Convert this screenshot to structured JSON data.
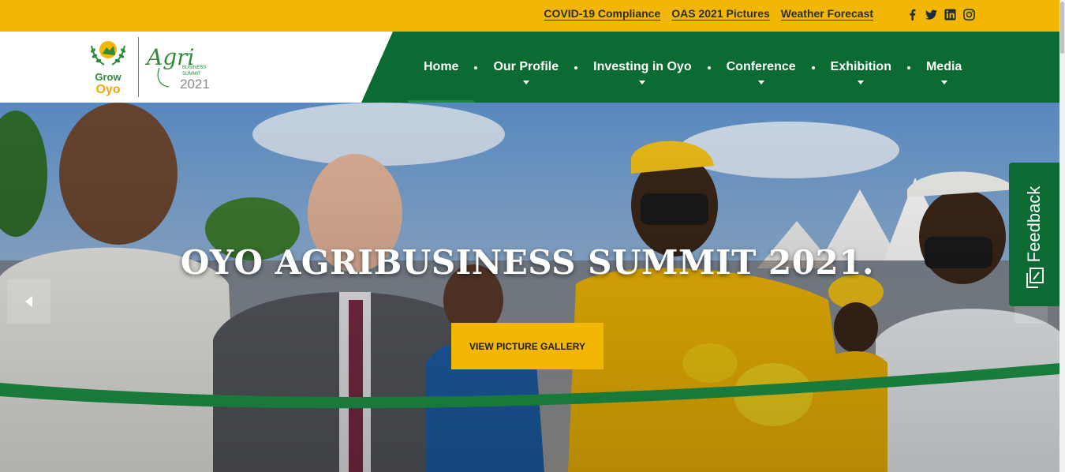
{
  "topbar": {
    "links": [
      "COVID-19 Compliance",
      "OAS 2021 Pictures",
      "Weather Forecast"
    ],
    "social_icons": [
      "facebook-icon",
      "twitter-icon",
      "linkedin-icon",
      "instagram-icon"
    ]
  },
  "logo": {
    "grow_text": "Grow",
    "oyo_text": "Oyo",
    "agri_text": "Agri",
    "business_text": "BUSINESS",
    "summit_text": "SUMMIT",
    "year_text": "2021"
  },
  "nav": {
    "items": [
      {
        "label": "Home",
        "active": true,
        "has_dropdown": false
      },
      {
        "label": "Our Profile",
        "active": false,
        "has_dropdown": true
      },
      {
        "label": "Investing in Oyo",
        "active": false,
        "has_dropdown": true
      },
      {
        "label": "Conference",
        "active": false,
        "has_dropdown": true
      },
      {
        "label": "Exhibition",
        "active": false,
        "has_dropdown": true
      },
      {
        "label": "Media",
        "active": false,
        "has_dropdown": true
      }
    ]
  },
  "hero": {
    "title": "OYO AGRIBUSINESS SUMMIT 2021.",
    "button_label": "VIEW PICTURE GALLERY"
  },
  "feedback": {
    "label": "Feedback"
  },
  "colors": {
    "accent_yellow": "#f2b705",
    "brand_green": "#0c6b32",
    "ribbon_green": "#1f9a4a"
  }
}
